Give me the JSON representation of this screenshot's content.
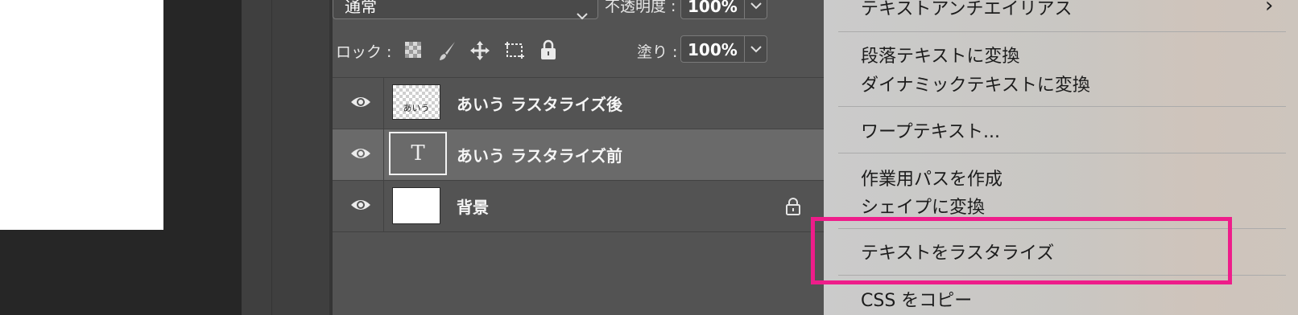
{
  "layers_panel": {
    "blend_mode": "通常",
    "opacity_label": "不透明度 :",
    "opacity_value": "100%",
    "lock_label": "ロック :",
    "fill_label": "塗り :",
    "fill_value": "100%",
    "layers": [
      {
        "name": "あいう ラスタライズ後",
        "thumb_text": "あいう",
        "selected": false,
        "locked": false
      },
      {
        "name": "あいう ラスタライズ前",
        "thumb_text": "T",
        "selected": true,
        "locked": false
      },
      {
        "name": "背景",
        "thumb_text": "",
        "selected": false,
        "locked": true
      }
    ]
  },
  "context_menu": {
    "items": [
      {
        "label": "テキストアンチエイリアス",
        "submenu": true
      },
      {
        "label": "段落テキストに変換"
      },
      {
        "label": "ダイナミックテキストに変換"
      },
      {
        "label": "ワープテキスト..."
      },
      {
        "label": "作業用パスを作成"
      },
      {
        "label": "シェイプに変換"
      },
      {
        "label": "テキストをラスタライズ",
        "highlighted": true
      },
      {
        "label": "CSS をコピー"
      }
    ],
    "submenu_arrow": "›"
  },
  "colors": {
    "highlight": "#ee1d8a",
    "panel_bg": "#535353",
    "selected_row": "#6a6a6a",
    "menu_bg": "#cbcbcb"
  }
}
